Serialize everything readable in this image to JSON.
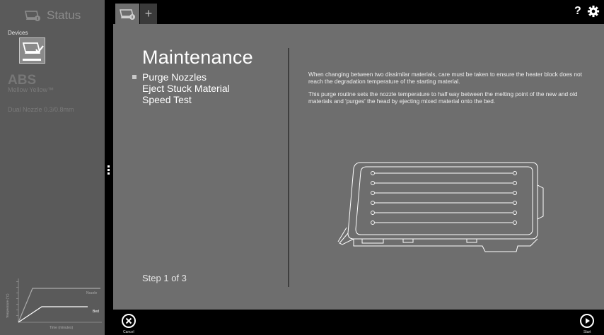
{
  "sidebar": {
    "title": "Status",
    "devices_label": "Devices",
    "device_icon": "printer-ready-icon",
    "material": "ABS",
    "colour": "Mellow Yellow™",
    "nozzle": "Dual Nozzle 0.3/0.8mm"
  },
  "temp_chart": {
    "ylabel": "Temperature (°C)",
    "xlabel": "Time (minutes)",
    "series": [
      {
        "name": "Nozzle"
      },
      {
        "name": "Bed"
      }
    ]
  },
  "tabs": {
    "add_label": "+"
  },
  "header": {
    "help_label": "?"
  },
  "main": {
    "title": "Maintenance",
    "steps": [
      {
        "label": "Purge Nozzles",
        "active": true
      },
      {
        "label": "Eject Stuck Material",
        "active": false
      },
      {
        "label": "Speed Test",
        "active": false
      }
    ],
    "step_count": "Step 1 of 3",
    "description": [
      "When changing between two dissimilar materials, care must be taken to ensure the heater block does not reach the degradation temperature of the starting material.",
      "This purge routine sets the nozzle temperature to half way between the melting point of the new and old materials and 'purges' the head by ejecting mixed material onto the bed."
    ]
  },
  "bottom": {
    "cancel_label": "Cancel",
    "start_label": "Start"
  },
  "colors": {
    "sidebar_bg": "#5a5a5a",
    "main_bg": "#6e6e6e",
    "bars_bg": "#000000"
  }
}
